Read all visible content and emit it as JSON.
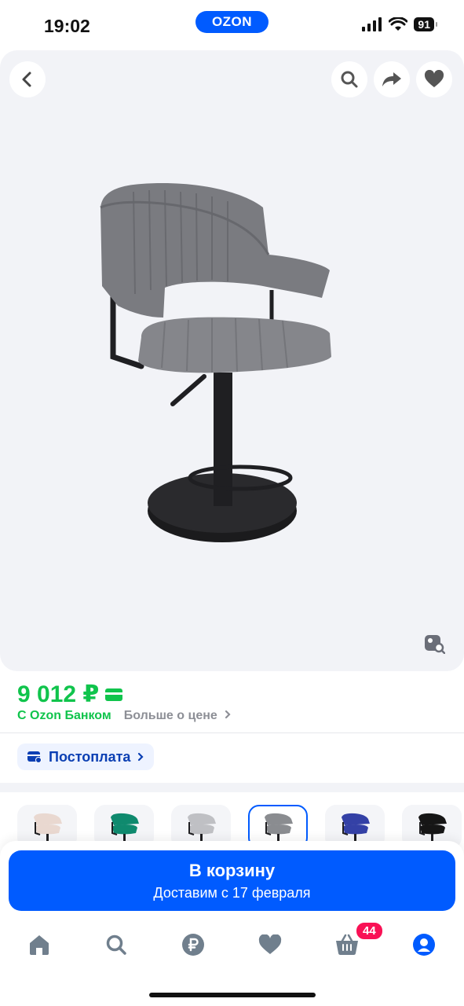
{
  "status_bar": {
    "time": "19:02",
    "logo": "OZON",
    "battery": "91"
  },
  "gallery": {
    "buttons": [
      "back-icon",
      "search-icon",
      "share-icon",
      "heart-icon"
    ],
    "visual_search_icon": "image-search-icon"
  },
  "price": {
    "amount": "9 012 ₽",
    "bank_label": "С Ozon Банком",
    "more_label": "Больше о цене",
    "color": "#10c44c"
  },
  "postpay": {
    "label": "Постоплата"
  },
  "variants": [
    {
      "color": "#e9d8d0",
      "selected": false
    },
    {
      "color": "#0f8a6e",
      "selected": false
    },
    {
      "color": "#bfc0c4",
      "selected": false
    },
    {
      "color": "#8a8c90",
      "selected": true
    },
    {
      "color": "#3441a6",
      "selected": false
    },
    {
      "color": "#161616",
      "selected": false
    }
  ],
  "cart": {
    "title": "В корзину",
    "subtitle": "Доставим с 17 февраля",
    "accent": "#005bff"
  },
  "tabbar": {
    "items": [
      "home-icon",
      "search-icon",
      "ruble-icon",
      "heart-icon",
      "cart-icon",
      "profile-icon"
    ],
    "cart_badge": "44"
  }
}
